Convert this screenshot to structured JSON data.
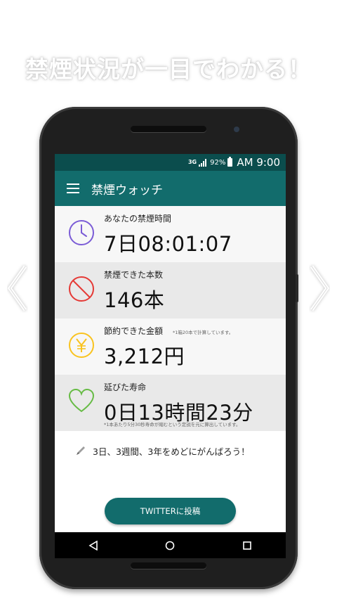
{
  "headline": "禁煙状況が一目でわかる！",
  "status_bar": {
    "network": "3G",
    "battery_pct": "92%",
    "time": "AM 9:00"
  },
  "app_bar": {
    "title": "禁煙ウォッチ"
  },
  "cards": [
    {
      "label": "あなたの禁煙時間",
      "value": "7日08:01:07",
      "icon": "clock-icon"
    },
    {
      "label": "禁煙できた本数",
      "value": "146本",
      "icon": "no-smoking-icon"
    },
    {
      "label": "節約できた金額",
      "note": "*1箱20本で計算しています。",
      "value": "3,212円",
      "icon": "yen-icon"
    },
    {
      "label": "延びた寿命",
      "value": "0日13時間23分",
      "subnote": "*1本あたり5分30秒寿命が縮むという定説を元に算出しています。",
      "icon": "heart-icon"
    }
  ],
  "goal_text": "3日、3週間、3年をめどにがんばろう！",
  "twitter_button": "TWITTERに投稿",
  "colors": {
    "primary": "#126c6c",
    "status_bar": "#0b4d4d",
    "clock": "#7b5cd6",
    "no_smoking": "#e53935",
    "yen": "#f9c31f",
    "heart": "#66bb44"
  }
}
